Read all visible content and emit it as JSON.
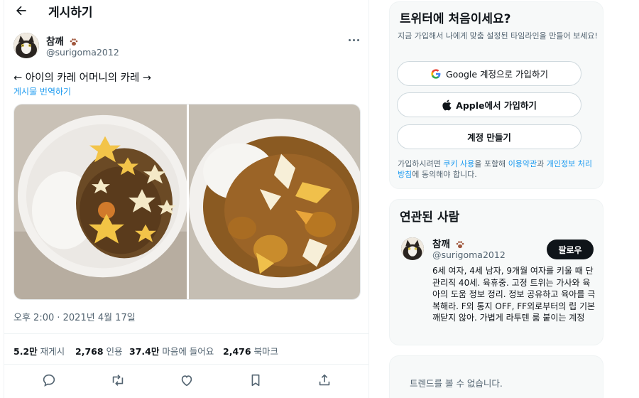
{
  "header": {
    "title": "게시하기",
    "back_icon": "arrow-left-icon"
  },
  "tweet": {
    "author": {
      "name": "참깨",
      "handle": "@surigoma2012"
    },
    "text": "← 아이의 카레 어머니의 카레 →",
    "translate_label": "게시물 번역하기",
    "timestamp": "오후 2:00 · 2021년 4월 17일",
    "stats": {
      "retweets": {
        "value": "5.2만",
        "label": "재게시"
      },
      "quotes": {
        "value": "2,768",
        "label": "인용"
      },
      "likes": {
        "value": "37.4만",
        "label": "마음에 들어요"
      },
      "bookmarks": {
        "value": "2,476",
        "label": "북마크"
      }
    },
    "actions": [
      "reply-icon",
      "retweet-icon",
      "like-icon",
      "bookmark-icon",
      "share-icon"
    ]
  },
  "signup": {
    "title": "트위터에 처음이세요?",
    "subtitle": "지금 가입해서 나에게 맞춤 설정된 타임라인을 만들어 보세요!",
    "google_label": "Google 계정으로 가입하기",
    "apple_label": "Apple에서 가입하기",
    "create_label": "계정 만들기",
    "legal": {
      "part1": "가입하시려면 ",
      "cookie_link": "쿠키 사용",
      "part2": "을 포함해 ",
      "terms_link": "이용약관",
      "part3": "과 ",
      "privacy_link": "개인정보 처리방침",
      "part4": "에 동의해야 합니다."
    }
  },
  "related": {
    "title": "연관된 사람",
    "user": {
      "name": "참깨",
      "handle": "@surigoma2012",
      "follow_label": "팔로우",
      "bio": "6세 여자, 4세 남자, 9개월 여자를 키울 때 단관리직 40세. 육휴중. 고정 트위는 가사와 육아의 도움 정보 정리. 정보 공유하고 육아를 극복해라. F외 통지 OFF, FF외로부터의 립 기본 깨닫지 않아. 가볍게 라투텐 룸 붙이는 계정"
    }
  },
  "trends": {
    "text": "트렌드를 볼 수 없습니다."
  },
  "colors": {
    "accent": "#1d9bf0",
    "text": "#0f1419",
    "muted": "#536471",
    "panel": "#f7f9f9"
  }
}
